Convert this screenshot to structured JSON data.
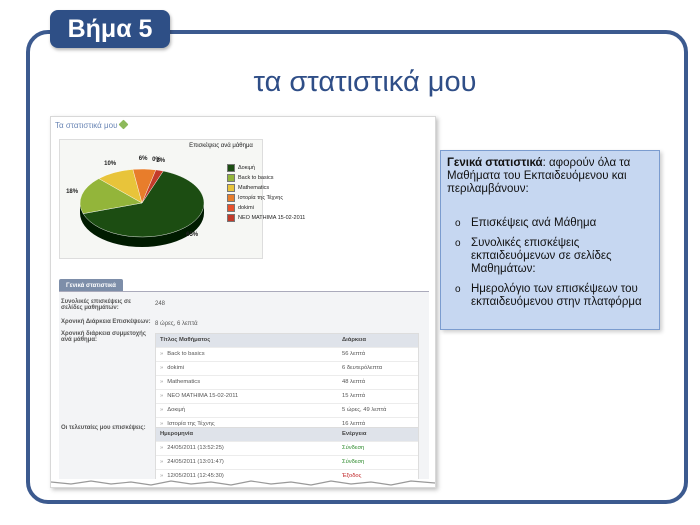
{
  "slide": {
    "step_label": "Βήμα 5",
    "title": "τα στατιστικά μου"
  },
  "screenshot": {
    "header": "Τα στατιστικά μου",
    "chart_title": "Επισκέψεις ανά μάθημα",
    "general_tab": "Γενικά στατιστικά",
    "total_visits_label": "Συνολικές επισκέψεις σε σελίδες μαθημάτων:",
    "total_visits_value": "248",
    "duration_label": "Χρονική Διάρκεια Επισκέψεων:",
    "duration_value": "8 ώρες, 6 λεπτά",
    "course_duration_label": "Χρονική διάρκεια συμμετοχής ανά μάθημα:",
    "courses_table": {
      "headers": [
        "Τίτλος Μαθήματος",
        "Διάρκεια"
      ],
      "rows": [
        [
          "Back to basics",
          "56 λεπτά"
        ],
        [
          "dokimi",
          "6 δευτερόλεπτα"
        ],
        [
          "Mathematics",
          "48 λεπτά"
        ],
        [
          "NEO MATHIMA 15-02-2011",
          "15 λεπτά"
        ],
        [
          "Δοκιμή",
          "5 ώρες, 49 λεπτά"
        ],
        [
          "Ιστορία της Τέχνης",
          "16 λεπτά"
        ]
      ]
    },
    "last_visits_label": "Οι τελευταίες μου επισκέψεις:",
    "visits_table": {
      "headers": [
        "Ημερομηνία",
        "Ενέργεια"
      ],
      "rows": [
        [
          "24/05/2011 (13:52:25)",
          "Σύνδεση"
        ],
        [
          "24/05/2011 (13:01:47)",
          "Σύνδεση"
        ],
        [
          "12/05/2011 (12:45:30)",
          "Έξοδος"
        ]
      ]
    }
  },
  "info_box": {
    "heading_bold": "Γενικά στατιστικά",
    "heading_rest": ": αφορούν όλα τα Μαθήματα του Εκπαιδευόμενου και περιλαμβάνουν:",
    "items": [
      "Επισκέψεις ανά Μάθημα",
      "Συνολικές επισκέψεις εκπαιδευόμενων σε σελίδες Μαθημάτων:",
      "Ημερολόγιο των επισκέψεων του εκπαιδευόμενου στην πλατφόρμα"
    ]
  },
  "colors": {
    "accent": "#2e4f86",
    "info_bg": "#c6d7f1",
    "login": "#2e8b2e",
    "logout": "#c0282a"
  },
  "chart_data": {
    "type": "pie",
    "title": "Επισκέψεις ανά μάθημα",
    "categories": [
      "Δοκιμή",
      "Back to basics",
      "Mathematics",
      "Ιστορία της Τέχνης",
      "dokimi",
      "NEO MATHIMA 15-02-2011"
    ],
    "values": [
      65,
      18,
      10,
      6,
      0,
      2
    ],
    "labels": [
      "65%",
      "18%",
      "10%",
      "6%",
      "0%",
      "2%"
    ],
    "colors": [
      "#1c4d12",
      "#93b53a",
      "#e8c43a",
      "#e87d2b",
      "#e8512b",
      "#c23b2a"
    ],
    "legend": "right"
  }
}
